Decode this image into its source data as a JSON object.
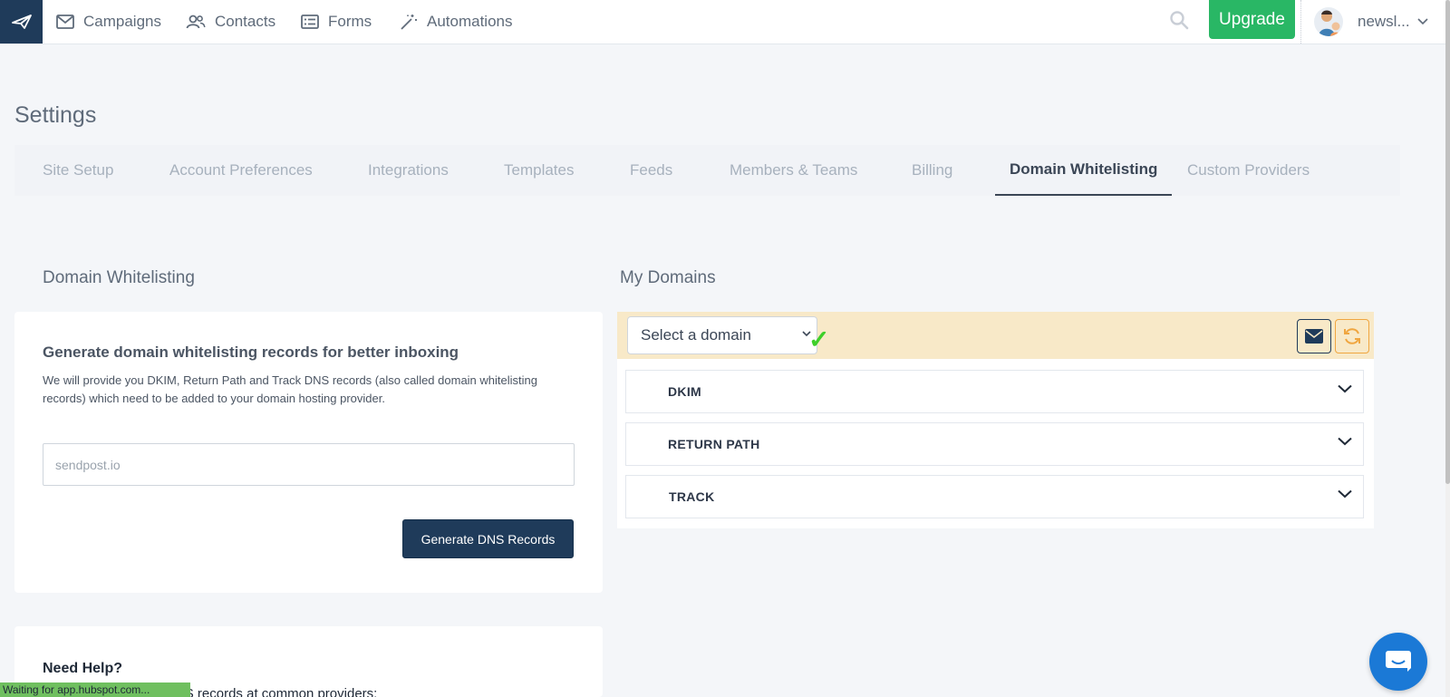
{
  "nav": {
    "items": [
      {
        "label": "Campaigns",
        "icon": "envelope-icon"
      },
      {
        "label": "Contacts",
        "icon": "users-icon"
      },
      {
        "label": "Forms",
        "icon": "form-icon"
      },
      {
        "label": "Automations",
        "icon": "magic-wand-icon"
      }
    ],
    "upgrade_label": "Upgrade",
    "user_name": "newsl..."
  },
  "page": {
    "title": "Settings"
  },
  "tabs": [
    {
      "label": "Site Setup",
      "active": false
    },
    {
      "label": "Account Preferences",
      "active": false
    },
    {
      "label": "Integrations",
      "active": false
    },
    {
      "label": "Templates",
      "active": false
    },
    {
      "label": "Feeds",
      "active": false
    },
    {
      "label": "Members & Teams",
      "active": false
    },
    {
      "label": "Billing",
      "active": false
    },
    {
      "label": "Domain Whitelisting",
      "active": true
    },
    {
      "label": "Custom Providers",
      "active": false
    }
  ],
  "left": {
    "section_title": "Domain Whitelisting",
    "card_title": "Generate domain whitelisting records for better inboxing",
    "card_desc": "We will provide you DKIM, Return Path and Track DNS records (also called domain whitelisting records) which need to be added to your domain hosting provider.",
    "domain_placeholder": "sendpost.io",
    "generate_label": "Generate DNS Records",
    "help_title": "Need Help?",
    "help_text": "n how to setup your DNS records at common providers:"
  },
  "right": {
    "section_title": "My Domains",
    "select_placeholder": "Select a domain",
    "check_glyph": "✓",
    "records": [
      {
        "label": "DKIM"
      },
      {
        "label": "RETURN PATH"
      },
      {
        "label": "TRACK"
      }
    ]
  },
  "status_bar": "Waiting for app.hubspot.com...",
  "colors": {
    "brand_dark": "#1f3b5a",
    "upgrade_green": "#29b765",
    "domain_bar": "#f8e9c8",
    "refresh_orange": "#f0a640",
    "chat_blue": "#1b79d6"
  }
}
